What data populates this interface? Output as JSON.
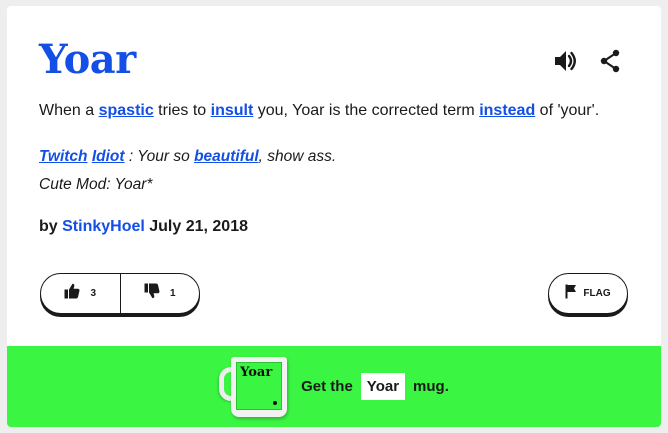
{
  "definition": {
    "word": "Yoar",
    "meaning_parts": {
      "p1": "When a ",
      "link1": "spastic",
      "p2": " tries to ",
      "link2": "insult",
      "p3": " you, Yoar is the corrected term ",
      "link3": "instead",
      "p4": " of 'your'."
    },
    "example_parts": {
      "link1": "Twitch",
      "link2": "Idiot",
      "p1": " : Your so ",
      "link3": "beautiful",
      "p2": ", show ass.",
      "line2": "Cute Mod: Yoar*"
    },
    "contributor": {
      "prefix": "by ",
      "author": "StinkyHoel",
      "date": " July 21, 2018"
    },
    "votes": {
      "up": "3",
      "down": "1"
    },
    "flag_label": "FLAG"
  },
  "mug_banner": {
    "prefix": "Get the",
    "word": "Yoar",
    "suffix": "mug.",
    "mug_word": "Yoar"
  },
  "icons": [
    "speaker-icon",
    "share-icon",
    "thumbs-up-icon",
    "thumbs-down-icon",
    "flag-icon",
    "mug-image"
  ],
  "colors": {
    "accent": "#134fe6",
    "banner": "#3bf543",
    "background": "#eeeeee",
    "text": "#1a1a1a"
  }
}
